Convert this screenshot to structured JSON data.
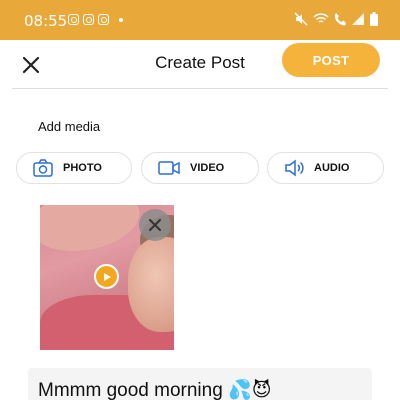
{
  "status_bar": {
    "time": "08:55",
    "left_icons": [
      "instagram-icon",
      "instagram-icon",
      "instagram-icon",
      "notification-dot-icon"
    ],
    "right_icons": [
      "mute-icon",
      "wifi-call-icon",
      "call-icon",
      "signal-icon",
      "battery-icon"
    ],
    "background": "#e8a93a"
  },
  "header": {
    "close_icon": "close-icon",
    "title": "Create Post",
    "post_label": "POST",
    "accent": "#f5b33b"
  },
  "media": {
    "heading": "Add media",
    "buttons": [
      {
        "label": "PHOTO",
        "icon": "camera-icon"
      },
      {
        "label": "VIDEO",
        "icon": "video-camera-icon"
      },
      {
        "label": "AUDIO",
        "icon": "speaker-icon"
      }
    ],
    "icon_color": "#2b6fd6"
  },
  "attachment": {
    "type": "video",
    "remove_icon": "close-icon",
    "play_icon": "play-icon",
    "play_color": "#f4a71d"
  },
  "caption": {
    "text": "Mmmm good morning 💦😈"
  }
}
